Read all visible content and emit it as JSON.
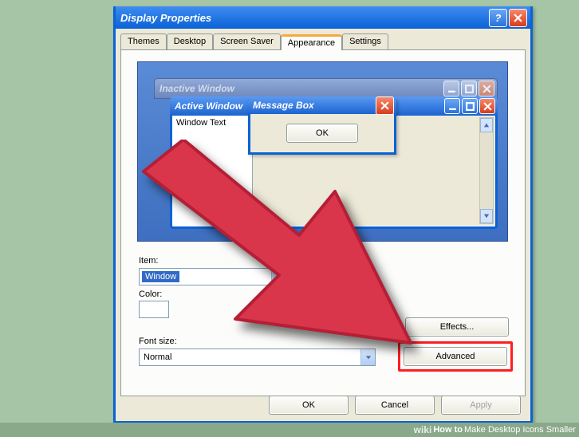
{
  "dialog": {
    "title": "Display Properties",
    "tabs": [
      "Themes",
      "Desktop",
      "Screen Saver",
      "Appearance",
      "Settings"
    ],
    "active_tab": "Appearance"
  },
  "preview": {
    "inactive_title": "Inactive Window",
    "active_title": "Active Window",
    "window_text": "Window Text",
    "msg_title": "Message Box",
    "msg_ok": "OK"
  },
  "form": {
    "item_label": "Item:",
    "item_value": "Window",
    "color_label": "Color:",
    "font_label": "Font size:",
    "font_value": "Normal",
    "effects": "Effects...",
    "advanced": "Advanced"
  },
  "buttons": {
    "ok": "OK",
    "cancel": "Cancel",
    "apply": "Apply"
  },
  "footer": {
    "brand": "wiki",
    "how": "How to ",
    "topic": "Make Desktop Icons Smaller"
  }
}
